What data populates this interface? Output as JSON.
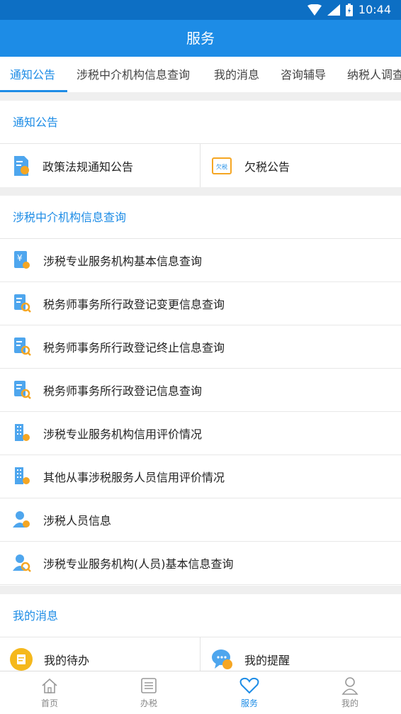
{
  "status": {
    "time": "10:44"
  },
  "header": {
    "title": "服务"
  },
  "tabs": [
    "通知公告",
    "涉税中介机构信息查询",
    "我的消息",
    "咨询辅导",
    "纳税人调查"
  ],
  "sections": {
    "notice": {
      "title": "通知公告",
      "items": [
        {
          "label": "政策法规通知公告",
          "icon": "document-icon"
        },
        {
          "label": "欠税公告",
          "icon": "tax-owed-icon",
          "badge": "欠税"
        }
      ]
    },
    "agency": {
      "title": "涉税中介机构信息查询",
      "items": [
        {
          "label": "涉税专业服务机构基本信息查询",
          "icon": "yuan-document-icon",
          "glyph": "¥"
        },
        {
          "label": "税务师事务所行政登记变更信息查询",
          "icon": "search-document-icon"
        },
        {
          "label": "税务师事务所行政登记终止信息查询",
          "icon": "search-document-icon"
        },
        {
          "label": "税务师事务所行政登记信息查询",
          "icon": "search-document-icon"
        },
        {
          "label": "涉税专业服务机构信用评价情况",
          "icon": "building-icon"
        },
        {
          "label": "其他从事涉税服务人员信用评价情况",
          "icon": "building-icon"
        },
        {
          "label": "涉税人员信息",
          "icon": "person-icon"
        },
        {
          "label": "涉税专业服务机构(人员)基本信息查询",
          "icon": "person-search-icon"
        }
      ]
    },
    "messages": {
      "title": "我的消息",
      "items": [
        {
          "label": "我的待办",
          "icon": "todo-icon"
        },
        {
          "label": "我的提醒",
          "icon": "chat-bubble-icon"
        }
      ]
    }
  },
  "nav": [
    {
      "label": "首页",
      "icon": "home-icon"
    },
    {
      "label": "办税",
      "icon": "list-icon"
    },
    {
      "label": "服务",
      "icon": "heart-icon",
      "active": true
    },
    {
      "label": "我的",
      "icon": "user-icon"
    }
  ],
  "colors": {
    "primary": "#1d8ce6",
    "statusbar": "#0d6fc4",
    "accent_orange": "#f5a623"
  }
}
